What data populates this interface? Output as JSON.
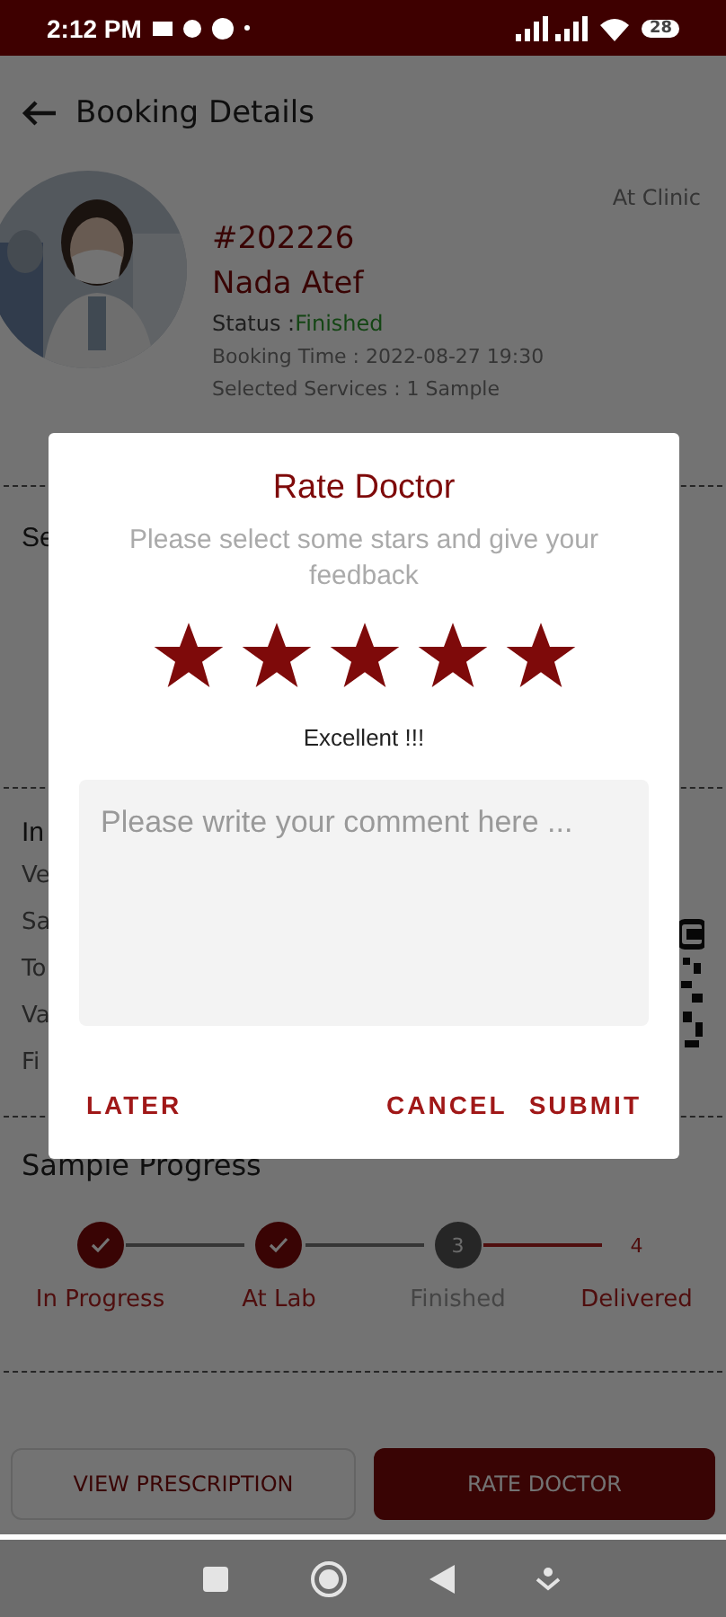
{
  "status_bar": {
    "time": "2:12 PM",
    "battery": "28"
  },
  "header": {
    "title": "Booking Details"
  },
  "booking": {
    "place": "At Clinic",
    "number": "#202226",
    "doctor": "Nada Atef",
    "status_label": "Status :",
    "status": "Finished",
    "booking_time": "Booking Time : 2022-08-27 19:30",
    "services": "Selected Services : 1 Sample"
  },
  "section_2": {
    "title": "Se"
  },
  "info": {
    "title": "In",
    "rows": [
      "Ve",
      "Sa",
      "To",
      "Va",
      "Fi"
    ]
  },
  "progress": {
    "title": "Sample Progress",
    "steps": [
      {
        "kind": "done",
        "label": "In Progress"
      },
      {
        "kind": "done",
        "label": "At Lab"
      },
      {
        "kind": "current",
        "number": "3",
        "label": "Finished"
      },
      {
        "kind": "pending",
        "number": "4",
        "label": "Delivered"
      }
    ]
  },
  "buttons": [
    {
      "kind": "outline",
      "label": "VIEW PRESCRIPTION"
    },
    {
      "kind": "filled",
      "label": "RATE DOCTOR"
    }
  ],
  "dialog": {
    "title": "Rate Doctor",
    "subtitle": "Please select some stars and give your feedback",
    "stars": 5,
    "rating_text": "Excellent !!!",
    "comment": {
      "placeholder": "Please write your comment here ..."
    },
    "actions": [
      {
        "kind": "left",
        "label": "LATER"
      },
      {
        "kind": "right",
        "label": "CANCEL"
      },
      {
        "kind": "right",
        "label": "SUBMIT"
      }
    ]
  }
}
